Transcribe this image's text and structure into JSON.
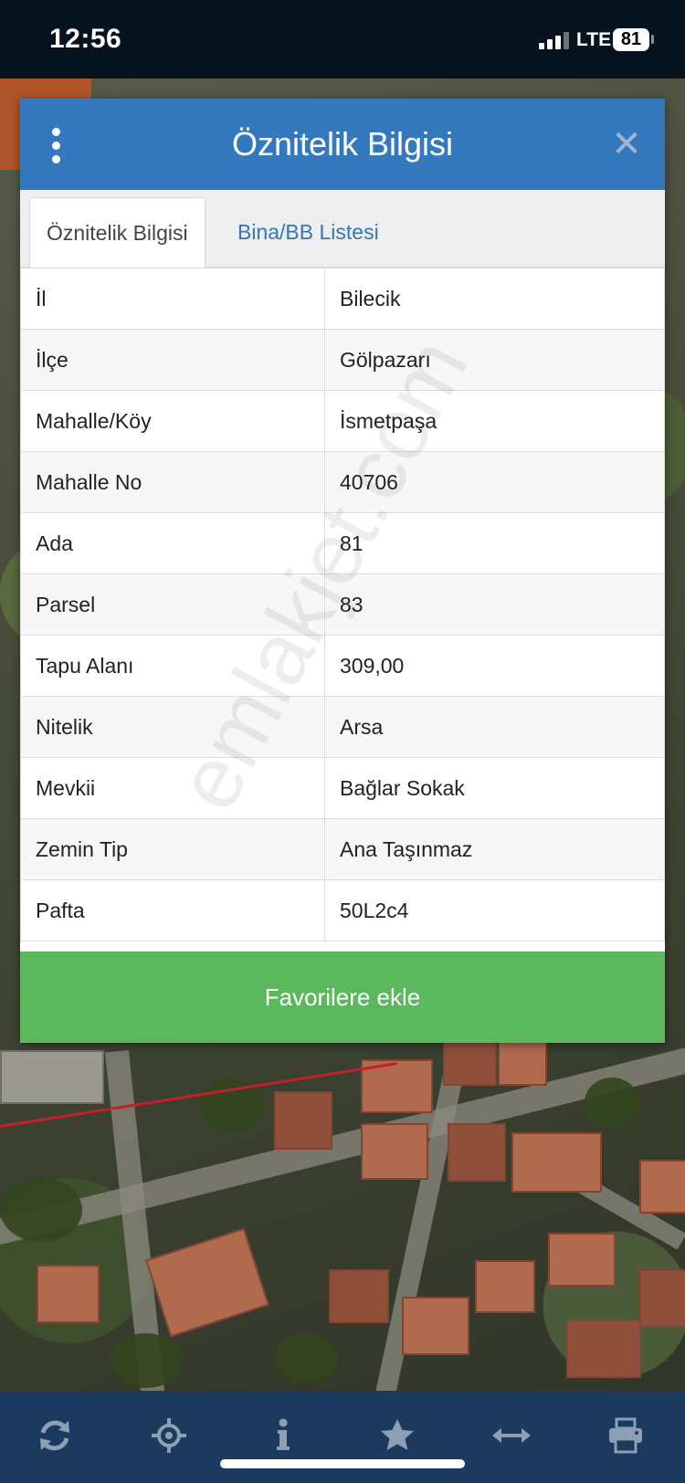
{
  "status_bar": {
    "time": "12:56",
    "network": "LTE",
    "battery": "81"
  },
  "dialog": {
    "title": "Öznitelik Bilgisi",
    "tabs": [
      {
        "label": "Öznitelik Bilgisi",
        "active": true
      },
      {
        "label": "Bina/BB Listesi",
        "active": false
      }
    ],
    "rows": [
      {
        "key": "İl",
        "value": "Bilecik"
      },
      {
        "key": "İlçe",
        "value": "Gölpazarı"
      },
      {
        "key": "Mahalle/Köy",
        "value": "İsmetpaşa"
      },
      {
        "key": "Mahalle No",
        "value": "40706"
      },
      {
        "key": "Ada",
        "value": "81"
      },
      {
        "key": "Parsel",
        "value": "83"
      },
      {
        "key": "Tapu Alanı",
        "value": "309,00"
      },
      {
        "key": "Nitelik",
        "value": "Arsa"
      },
      {
        "key": "Mevkii",
        "value": "Bağlar Sokak"
      },
      {
        "key": "Zemin Tip",
        "value": "Ana Taşınmaz"
      },
      {
        "key": "Pafta",
        "value": "50L2c4"
      }
    ],
    "favorite_button": "Favorilere ekle",
    "watermark": "emlakjet.com"
  },
  "toolbar": {
    "icons": [
      "refresh-icon",
      "locate-icon",
      "info-icon",
      "star-icon",
      "measure-icon",
      "print-icon"
    ]
  },
  "colors": {
    "header_blue": "#3479bd",
    "tab_link_blue": "#2f79b9",
    "button_green": "#5cb85c",
    "toolbar_navy": "#1c3a5e",
    "status_bar": "#06131f"
  }
}
